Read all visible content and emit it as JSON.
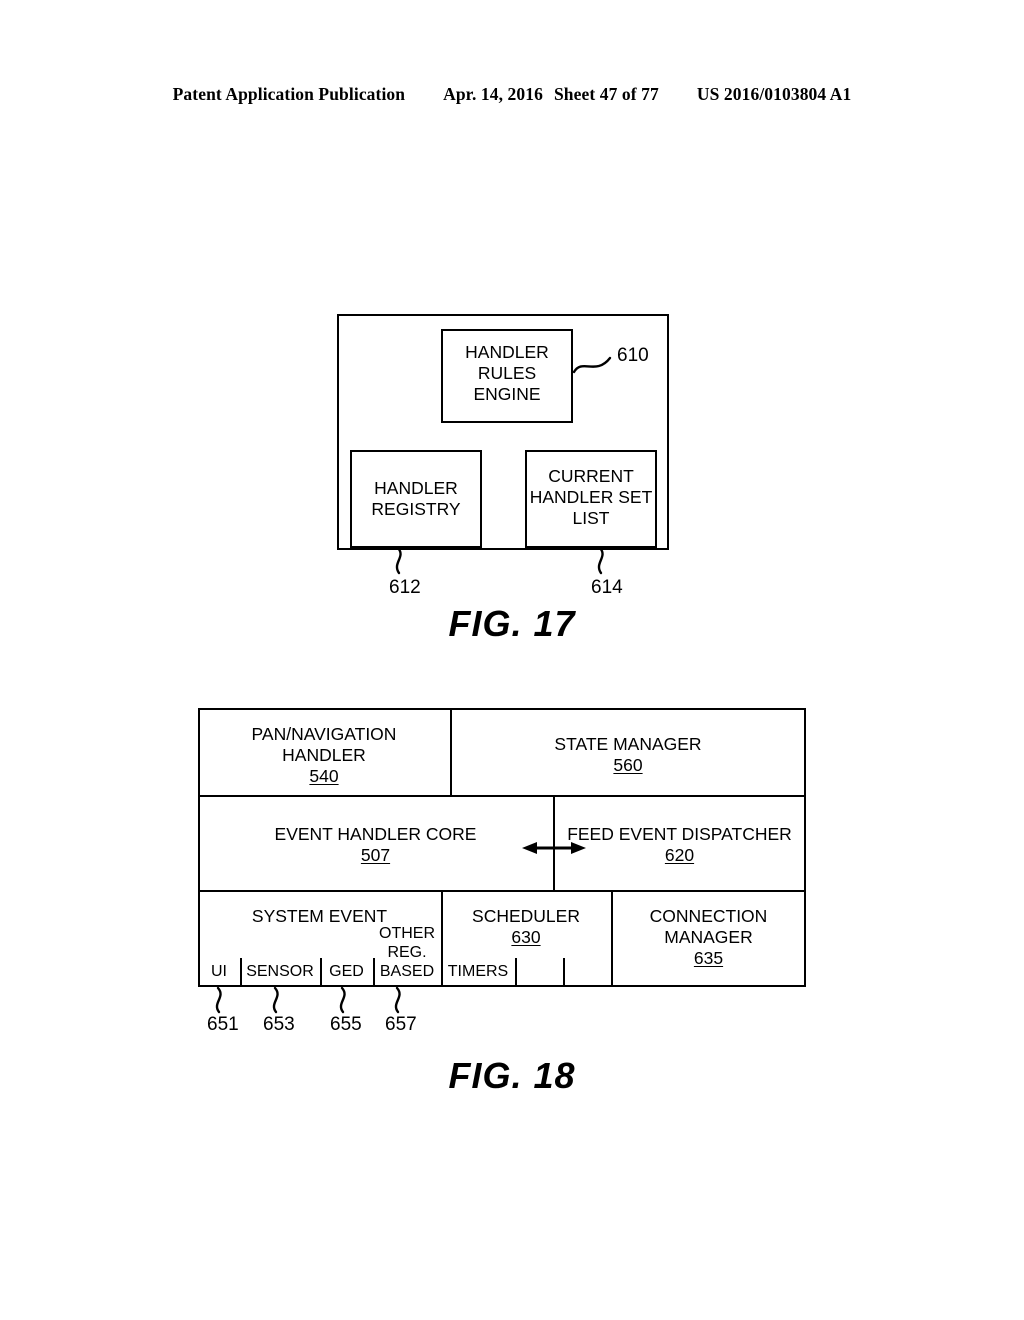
{
  "header": {
    "publication": "Patent Application Publication",
    "date": "Apr. 14, 2016",
    "sheet": "Sheet 47 of 77",
    "doc_number": "US 2016/0103804 A1"
  },
  "fig17": {
    "caption": "FIG. 17",
    "outer_ref": "610",
    "blocks": [
      {
        "name": "handler-rules-engine",
        "lines": [
          "HANDLER",
          "RULES",
          "ENGINE"
        ],
        "ref": "610"
      },
      {
        "name": "handler-registry",
        "lines": [
          "HANDLER",
          "REGISTRY"
        ],
        "ref": "612"
      },
      {
        "name": "current-handler-set-list",
        "lines": [
          "CURRENT",
          "HANDLER SET",
          "LIST"
        ],
        "ref": "614"
      }
    ],
    "refs": {
      "engine": "610",
      "registry": "612",
      "set_list": "614"
    }
  },
  "fig18": {
    "caption": "FIG. 18",
    "row1": [
      {
        "title_line1": "PAN/NAVIGATION",
        "title_line2": "HANDLER",
        "ref": "540"
      },
      {
        "title_line1": "STATE MANAGER",
        "title_line2": "",
        "ref": "560"
      }
    ],
    "row2": [
      {
        "title": "EVENT HANDLER CORE",
        "ref": "507"
      },
      {
        "title": "FEED EVENT DISPATCHER",
        "ref": "620"
      }
    ],
    "row3": [
      {
        "title": "SYSTEM EVENT",
        "ref": ""
      },
      {
        "title": "SCHEDULER",
        "ref": "630"
      },
      {
        "title_line1": "CONNECTION",
        "title_line2": "MANAGER",
        "ref": "635"
      }
    ],
    "system_event_subcells": [
      {
        "label": "UI",
        "ref": "651"
      },
      {
        "label": "SENSOR",
        "ref": "653"
      },
      {
        "label": "GED",
        "ref": "655"
      },
      {
        "label_line1": "OTHER",
        "label_line2": "REG.",
        "label_line3": "BASED",
        "ref": "657"
      }
    ],
    "scheduler_subcells": [
      {
        "label": "TIMERS"
      },
      {
        "label": ""
      },
      {
        "label": ""
      }
    ],
    "connector": "double-arrow"
  },
  "colors": {
    "ink": "#000000",
    "paper": "#ffffff"
  }
}
